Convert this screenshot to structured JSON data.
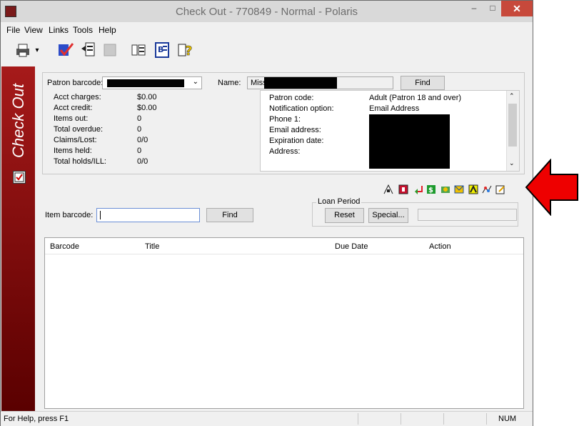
{
  "window": {
    "title": "Check Out - 770849 - Normal - Polaris",
    "close_glyph": "✕",
    "minimize_glyph": "–",
    "maximize_glyph": "□"
  },
  "menu": [
    "File",
    "View",
    "Links",
    "Tools",
    "Help"
  ],
  "sidebar": {
    "banner": "Check Out"
  },
  "patron": {
    "barcode_label": "Patron barcode:",
    "name_label": "Name:",
    "name_prefix": "Miss",
    "find_label": "Find",
    "summary": [
      {
        "label": "Acct charges:",
        "value": "$0.00"
      },
      {
        "label": "Acct credit:",
        "value": "$0.00"
      },
      {
        "label": "Items out:",
        "value": "0"
      },
      {
        "label": "Total overdue:",
        "value": "0"
      },
      {
        "label": "Claims/Lost:",
        "value": "0/0"
      },
      {
        "label": "Items held:",
        "value": "0"
      },
      {
        "label": "Total holds/ILL:",
        "value": "0/0"
      }
    ],
    "details": [
      {
        "label": "Patron code:",
        "value": "Adult (Patron 18 and over)"
      },
      {
        "label": "Notification option:",
        "value": "Email Address"
      },
      {
        "label": "Phone 1:",
        "value": ""
      },
      {
        "label": "Email address:",
        "value": ""
      },
      {
        "label": "Expiration date:",
        "value": ""
      },
      {
        "label": "Address:",
        "value": ""
      }
    ]
  },
  "item": {
    "barcode_label": "Item barcode:",
    "find_label": "Find"
  },
  "loan_period": {
    "title": "Loan Period",
    "reset_label": "Reset",
    "special_label": "Special..."
  },
  "grid": {
    "columns": [
      "Barcode",
      "Title",
      "Due Date",
      "Action"
    ]
  },
  "status": {
    "help": "For Help, press F1",
    "num": "NUM"
  },
  "colors": {
    "banner_top": "#a61a1a",
    "banner_bottom": "#5a0000",
    "close_button": "#c7493b",
    "annotation_arrow": "#ee0000"
  }
}
